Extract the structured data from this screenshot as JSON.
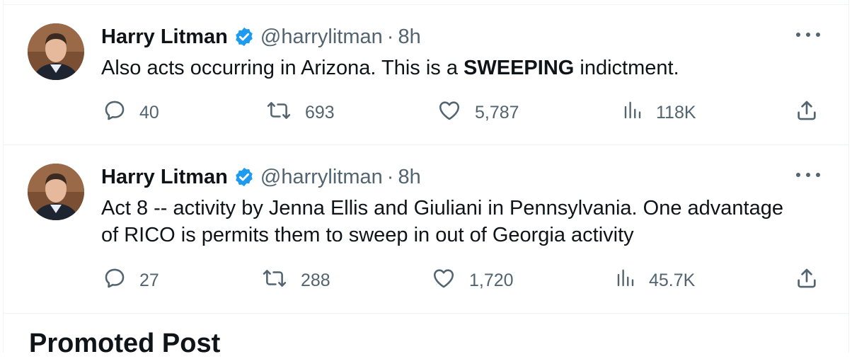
{
  "tweets": [
    {
      "author": "Harry Litman",
      "handle": "@harrylitman",
      "separator": "·",
      "time": "8h",
      "text_before": "Also acts occurring in Arizona.  This is a ",
      "text_bold": "SWEEPING",
      "text_after": " indictment.",
      "replies": "40",
      "reposts": "693",
      "likes": "5,787",
      "views": "118K"
    },
    {
      "author": "Harry Litman",
      "handle": "@harrylitman",
      "separator": "·",
      "time": "8h",
      "text_line1": "Act 8 -- activity by Jenna Ellis and Giuliani in Pennsylvania.  One advantage",
      "text_line2": "of RICO is permits them to sweep in out of Georgia activity",
      "replies": "27",
      "reposts": "288",
      "likes": "1,720",
      "views": "45.7K"
    }
  ],
  "promoted_label": "Promoted Post",
  "icons": [
    "verified-badge-icon",
    "more-icon",
    "reply-icon",
    "repost-icon",
    "like-icon",
    "views-icon",
    "share-icon"
  ],
  "colors": {
    "verified": "#1d9bf0",
    "secondary_text": "#536471",
    "primary_text": "#0f1419",
    "divider": "#eff3f4"
  }
}
